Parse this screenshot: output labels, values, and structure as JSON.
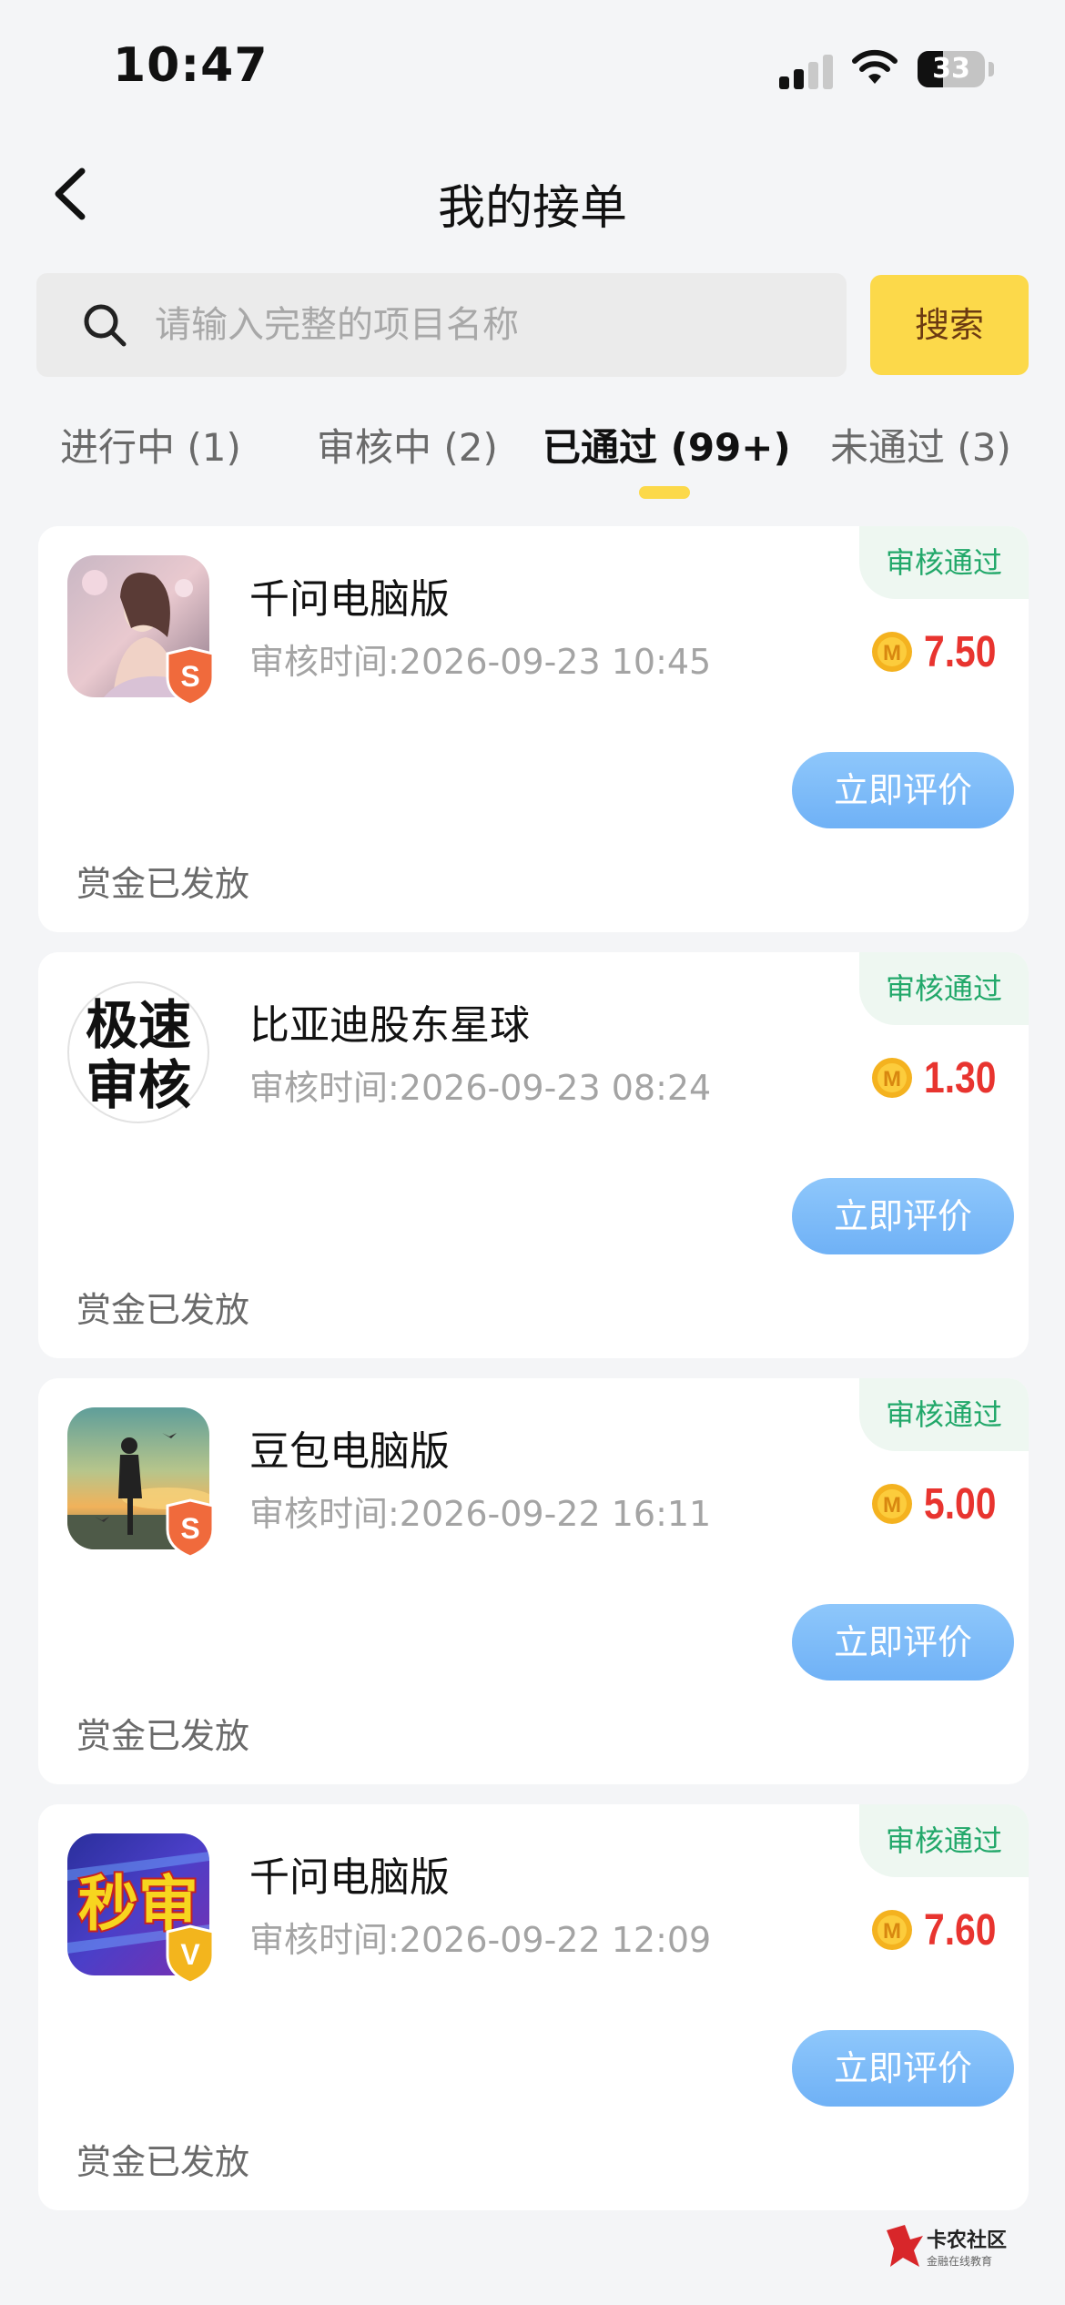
{
  "status_bar": {
    "time": "10:47",
    "battery": "33"
  },
  "header": {
    "title": "我的接单"
  },
  "search": {
    "placeholder": "请输入完整的项目名称",
    "button_label": "搜索"
  },
  "tabs": [
    {
      "label": "进行中 (1)"
    },
    {
      "label": "审核中 (2)"
    },
    {
      "label": "已通过 (99+)",
      "active": true
    },
    {
      "label": "未通过 (3)"
    }
  ],
  "orders": [
    {
      "status_tag": "审核通过",
      "icon": "anime-girl-app-icon",
      "badge": "S",
      "name": "千问电脑版",
      "review_time": "审核时间:2026-09-23 10:45",
      "reward": "7.50",
      "action_label": "立即评价",
      "payout": "赏金已发放"
    },
    {
      "status_tag": "审核通过",
      "icon": "speed-review-app-icon",
      "icon_text_1": "极速",
      "icon_text_2": "审核",
      "name": "比亚迪股东星球",
      "review_time": "审核时间:2026-09-23 08:24",
      "reward": "1.30",
      "action_label": "立即评价",
      "payout": "赏金已发放"
    },
    {
      "status_tag": "审核通过",
      "icon": "sunset-figure-app-icon",
      "badge": "S",
      "name": "豆包电脑版",
      "review_time": "审核时间:2026-09-22 16:11",
      "reward": "5.00",
      "action_label": "立即评价",
      "payout": "赏金已发放"
    },
    {
      "status_tag": "审核通过",
      "icon": "instant-review-app-icon",
      "icon_text": "秒审",
      "badge": "V",
      "name": "千问电脑版",
      "review_time": "审核时间:2026-09-22 12:09",
      "reward": "7.60",
      "action_label": "立即评价",
      "payout": "赏金已发放"
    }
  ],
  "coin_label": "M",
  "colors": {
    "accent_yellow": "#fcd94a",
    "approved_green": "#22a86a",
    "reward_red": "#e8342f",
    "button_blue": "#6fb1f6"
  },
  "watermark": {
    "text": "卡农社区",
    "subtext": "金融在线教育"
  }
}
